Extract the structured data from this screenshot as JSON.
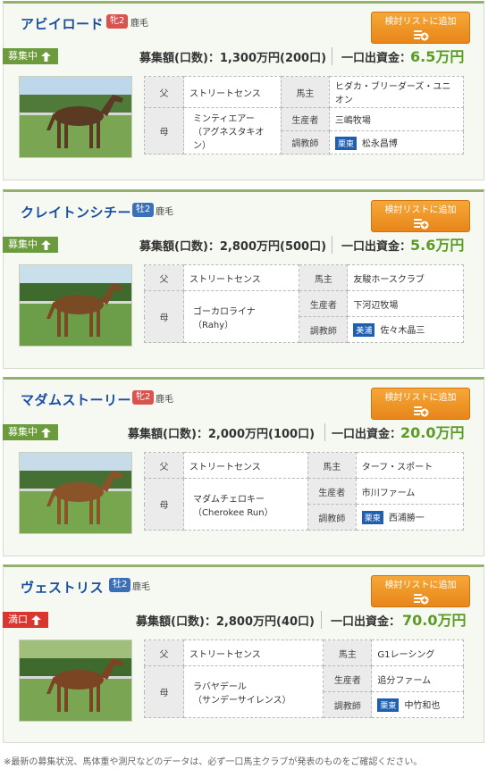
{
  "horses": [
    {
      "name": "アビイロード",
      "sex_badge": "牝2",
      "sex_type": "female",
      "coat": "鹿毛",
      "status": "募集中",
      "status_type": "open",
      "funding": "募集額(口数)：1,300万円(200口)",
      "unit_label": "一口出資金：",
      "unit_price": "6.5万円",
      "sire": "ストリートセンス",
      "dam": "ミンティエアー",
      "dam_sire": "（アグネスタキオン）",
      "owner": "ヒダカ・ブリーダーズ・ユニオン",
      "breeder": "三嶋牧場",
      "trainer_region": "栗東",
      "trainer": "松永昌博"
    },
    {
      "name": "クレイトンシチー",
      "sex_badge": "牡2",
      "sex_type": "male",
      "coat": "鹿毛",
      "status": "募集中",
      "status_type": "open",
      "funding": "募集額(口数)：2,800万円(500口)",
      "unit_label": "一口出資金：",
      "unit_price": "5.6万円",
      "sire": "ストリートセンス",
      "dam": "ゴーカロライナ",
      "dam_sire": "（Rahy）",
      "owner": "友駿ホースクラブ",
      "breeder": "下河辺牧場",
      "trainer_region": "美浦",
      "trainer": "佐々木晶三"
    },
    {
      "name": "マダムストーリー",
      "sex_badge": "牝2",
      "sex_type": "female",
      "coat": "鹿毛",
      "status": "募集中",
      "status_type": "open",
      "funding": "募集額(口数)：2,000万円(100口)",
      "unit_label": "一口出資金：",
      "unit_price": "20.0万円",
      "sire": "ストリートセンス",
      "dam": "マダムチェロキー",
      "dam_sire": "（Cherokee Run）",
      "owner": "ターフ・スポート",
      "breeder": "市川ファーム",
      "trainer_region": "栗東",
      "trainer": "西浦勝一"
    },
    {
      "name": "ヴェストリス",
      "sex_badge": "牡2",
      "sex_type": "male",
      "coat": "鹿毛",
      "status": "満口",
      "status_type": "full",
      "funding": "募集額(口数)：2,800万円(40口)",
      "unit_label": "一口出資金：",
      "unit_price": "70.0万円",
      "sire": "ストリートセンス",
      "dam": "ラバヤデール",
      "dam_sire": "（サンデーサイレンス）",
      "owner": "G1レーシング",
      "breeder": "追分ファーム",
      "trainer_region": "栗東",
      "trainer": "中竹和也"
    }
  ],
  "labels": {
    "sire": "父",
    "dam": "母",
    "owner": "馬主",
    "breeder": "生産者",
    "trainer": "調教師",
    "add_button": "検討リストに追加"
  },
  "footnote": "※最新の募集状況、馬体重や測尺などのデータは、必ず一口馬主クラブが発表のものをご確認ください。",
  "colors": {
    "accent_green": "#5a9b25",
    "name_blue": "#1a4fa0",
    "button_orange": "#f09a2a",
    "status_open": "#6b9b3c",
    "status_full": "#d9362e"
  }
}
